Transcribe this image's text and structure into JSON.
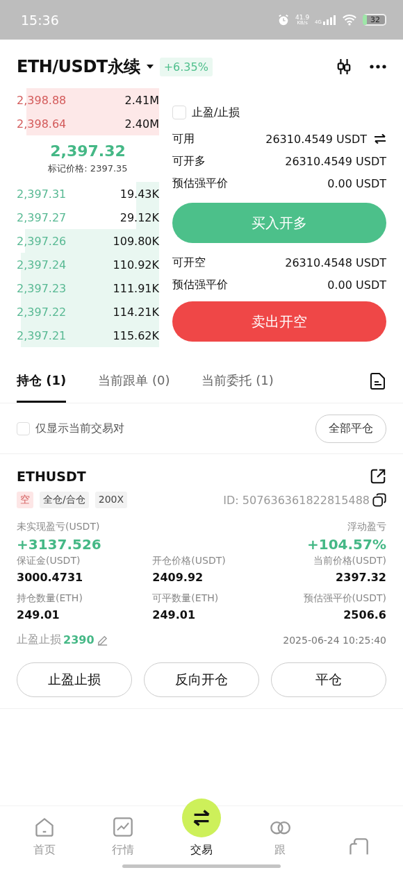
{
  "status_bar": {
    "time": "15:36",
    "net_speed": "41.9",
    "net_unit": "KB/s",
    "network": "4G",
    "battery": "32"
  },
  "header": {
    "symbol": "ETH/USDT永续",
    "change": "+6.35%"
  },
  "order_book": {
    "asks": [
      {
        "price": "2,398.88",
        "size": "2.41M"
      },
      {
        "price": "2,398.64",
        "size": "2.40M"
      }
    ],
    "last_price": "2,397.32",
    "mark_price": "标记价格: 2397.35",
    "bids": [
      {
        "price": "2,397.31",
        "size": "19.43K"
      },
      {
        "price": "2,397.27",
        "size": "29.12K"
      },
      {
        "price": "2,397.26",
        "size": "109.80K"
      },
      {
        "price": "2,397.24",
        "size": "110.92K"
      },
      {
        "price": "2,397.23",
        "size": "111.91K"
      },
      {
        "price": "2,397.22",
        "size": "114.21K"
      },
      {
        "price": "2,397.21",
        "size": "115.62K"
      }
    ]
  },
  "order_form": {
    "tp_sl": {
      "label": "止盈/止损",
      "checked": false
    },
    "long_info": [
      {
        "label": "可用",
        "value": "26310.4549 USDT"
      },
      {
        "label": "可开多",
        "value": "26310.4549 USDT"
      },
      {
        "label": "预估强平价",
        "value": "0.00 USDT"
      }
    ],
    "buy_button": "买入开多",
    "short_info": [
      {
        "label": "可开空",
        "value": "26310.4548 USDT"
      },
      {
        "label": "预估强平价",
        "value": "0.00 USDT"
      }
    ],
    "sell_button": "卖出开空"
  },
  "tabs": [
    {
      "label": "持仓 (1)",
      "selected": true
    },
    {
      "label": "当前跟单 (0)",
      "selected": false
    },
    {
      "label": "当前委托 (1)",
      "selected": false
    }
  ],
  "filter": {
    "label": "仅显示当前交易对",
    "checked": false,
    "close_all": "全部平仓"
  },
  "position": {
    "symbol": "ETHUSDT",
    "tags": [
      {
        "text": "空",
        "kind": "side"
      },
      {
        "text": "全仓/合仓",
        "kind": "plain"
      },
      {
        "text": "200X",
        "kind": "plain"
      }
    ],
    "id": "ID:  507636361822815488",
    "pnl_label": "未实现盈亏(USDT)",
    "pnl": "+3137.526",
    "roe_label": "浮动盈亏",
    "roe": "+104.57%",
    "fields": [
      {
        "label": "保证金(USDT)",
        "value": "3000.4731"
      },
      {
        "label": "开仓价格(USDT)",
        "value": "2409.92"
      },
      {
        "label": "当前价格(USDT)",
        "value": "2397.32"
      },
      {
        "label": "持仓数量(ETH)",
        "value": "249.01"
      },
      {
        "label": "可平数量(ETH)",
        "value": "249.01"
      },
      {
        "label": "预估强平价(USDT)",
        "value": "2506.6"
      }
    ],
    "tp_sl_label": "止盈止损",
    "tp_sl_value": "2390",
    "time": "2025-06-24 10:25:40",
    "buttons": [
      "止盈止损",
      "反向开仓",
      "平仓"
    ]
  },
  "nav": [
    {
      "label": "首页",
      "selected": false
    },
    {
      "label": "行情",
      "selected": false
    },
    {
      "label": "交易",
      "selected": true
    },
    {
      "label": "跟",
      "selected": false
    },
    {
      "selected": false
    }
  ]
}
